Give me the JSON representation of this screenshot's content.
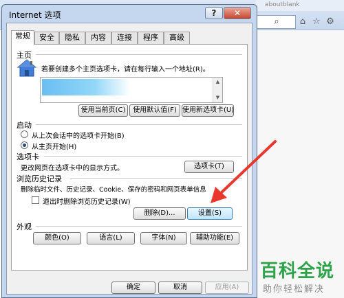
{
  "dialog": {
    "title": "Internet 选项",
    "help_label": "?",
    "close_label": "✕"
  },
  "tabs": [
    "常规",
    "安全",
    "隐私",
    "内容",
    "连接",
    "程序",
    "高级"
  ],
  "home": {
    "title": "主页",
    "instruction": "若要创建多个主页选项卡，请在每行输入一个地址(R)。",
    "buttons": [
      "使用当前页(C)",
      "使用默认值(F)",
      "使用新选项卡(U)"
    ]
  },
  "startup": {
    "title": "启动",
    "options": [
      "从上次会话中的选项卡开始(B)",
      "从主页开始(H)"
    ],
    "selected_index": 1
  },
  "tabs_section": {
    "title": "选项卡",
    "description": "更改网页在选项卡中的显示方式。",
    "button": "选项卡(T)"
  },
  "history": {
    "title": "浏览历史记录",
    "description": "删除临时文件、历史记录、Cookie、保存的密码和网页表单信息",
    "checkbox_label": "退出时删除浏览历史记录(W)",
    "checkbox_checked": false,
    "delete_button": "删除(D)...",
    "settings_button": "设置(S)"
  },
  "appearance": {
    "title": "外观",
    "buttons": [
      "颜色(O)",
      "语言(L)",
      "字体(N)",
      "辅助功能(E)"
    ]
  },
  "footer": {
    "ok": "确定",
    "cancel": "取消",
    "apply": "应用(A)"
  },
  "browser": {
    "tab_text": "aboutblank",
    "icons": [
      "search-icon",
      "home-icon",
      "favorites-star-icon",
      "settings-gear-icon"
    ]
  },
  "watermark": {
    "logo": "百科全说",
    "slogan": "助你轻松解决"
  },
  "colors": {
    "arrow": "#e8372c",
    "watermark_green": "#2ea34a"
  }
}
